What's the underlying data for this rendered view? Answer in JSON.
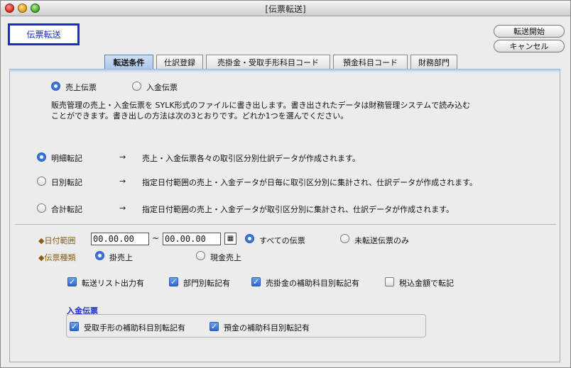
{
  "window": {
    "title": "[伝票転送]"
  },
  "header": {
    "title_box": "伝票転送"
  },
  "buttons": {
    "start": "転送開始",
    "cancel": "キャンセル"
  },
  "tabs": [
    "転送条件",
    "仕訳登録",
    "売掛金・受取手形科目コード",
    "預金科目コード",
    "財務部門"
  ],
  "slip_select": {
    "sales": "売上伝票",
    "receipt": "入金伝票",
    "selected": "sales"
  },
  "description": {
    "line1": "販売管理の売上・入金伝票を SYLK形式のファイルに書き出します。書き出されたデータは財務管理システムで読み込む",
    "line2": "ことができます。書き出しの方法は次の3とおりです。どれか1つを選んでください。"
  },
  "methods": {
    "arrow": "→",
    "detail": {
      "label": "明細転記",
      "desc": "売上・入金伝票各々の取引区分別仕訳データが作成されます。"
    },
    "daily": {
      "label": "日別転記",
      "desc": "指定日付範囲の売上・入金データが日毎に取引区分別に集計され、仕訳データが作成されます。"
    },
    "total": {
      "label": "合計転記",
      "desc": "指定日付範囲の売上・入金データが取引区分別に集計され、仕訳データが作成されます。"
    },
    "selected": "detail"
  },
  "date_range": {
    "label": "◆日付範囲",
    "from": "00.00.00",
    "tilde": "~",
    "to": "00.00.00",
    "all_slips": "すべての伝票",
    "untransferred_only": "未転送伝票のみ",
    "selected": "all_slips"
  },
  "slip_type": {
    "label": "◆伝票種類",
    "credit_sales": "掛売上",
    "cash_sales": "現金売上",
    "selected": "credit_sales"
  },
  "options": [
    {
      "label": "転送リスト出力有",
      "checked": true
    },
    {
      "label": "部門別転記有",
      "checked": true
    },
    {
      "label": "売掛金の補助科目別転記有",
      "checked": true
    },
    {
      "label": "税込金額で転記",
      "checked": false
    }
  ],
  "receipt_section": {
    "title": "入金伝票",
    "options": [
      {
        "label": "受取手形の補助科目別転記有",
        "checked": true
      },
      {
        "label": "預金の補助科目別転記有",
        "checked": true
      }
    ]
  },
  "colors": {
    "accent_blue": "#1a2bd1",
    "label_brown": "#8a5c1a"
  }
}
